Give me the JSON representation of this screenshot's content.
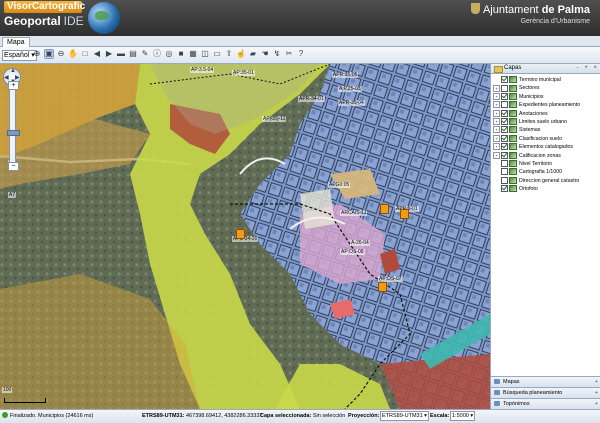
{
  "header": {
    "visor_label": "VisorCartografic",
    "geoportal_label": "Geoportal",
    "ide_label": "IDE",
    "org_prefix": "Ajuntament",
    "org_name": "de Palma",
    "org_dept": "Gerència d'Urbanisme"
  },
  "tabs": [
    {
      "label": "Mapa"
    }
  ],
  "toolbar": {
    "language": "Español",
    "tool_icons": [
      "zoom-in-icon",
      "zoom-box-icon",
      "zoom-out-icon",
      "pan-icon",
      "zoom-extent-icon",
      "back-icon",
      "forward-icon",
      "ruler-icon",
      "area-icon",
      "pencil-icon",
      "info-icon",
      "locate-icon",
      "stop-icon",
      "print-icon",
      "layer-add-icon",
      "select-icon",
      "export-icon",
      "pointer-icon",
      "bookmark-icon",
      "hand-icon",
      "route-icon",
      "tools-icon",
      "help-icon"
    ]
  },
  "map": {
    "labels": [
      "AP:3.5-04",
      "AP:35-01",
      "APR:35-05",
      "A:P,25-03",
      "AP(05)-11",
      "APR-34-01",
      "APR-35-04",
      "APG0:05",
      "APR:6-01",
      "APS-34-20",
      "A-26-04",
      "ARCA/S-11",
      "AP:OS-08",
      "AP:OS-07",
      "A7",
      "A7",
      "100"
    ]
  },
  "panel": {
    "title": "Capas",
    "controls": "- + ×",
    "layers": [
      {
        "label": "Termino municipal",
        "expand": "",
        "checked": true
      },
      {
        "label": "Sectores",
        "expand": "+",
        "checked": false
      },
      {
        "label": "Municipios",
        "expand": "+",
        "checked": true
      },
      {
        "label": "Expedientes planeamiento",
        "expand": "+",
        "checked": false
      },
      {
        "label": "Anotaciones",
        "expand": "+",
        "checked": true
      },
      {
        "label": "Limites suelo urbano",
        "expand": "+",
        "checked": true
      },
      {
        "label": "Sistemas",
        "expand": "+",
        "checked": true
      },
      {
        "label": "Clasificacion suelo",
        "expand": "+",
        "checked": true
      },
      {
        "label": "Elementos catalogados",
        "expand": "+",
        "checked": true
      },
      {
        "label": "Calificacion zonas",
        "expand": "+",
        "checked": true
      },
      {
        "label": "Nivel Territorio",
        "expand": "",
        "checked": false
      },
      {
        "label": "Cartografia 1/1000",
        "expand": "",
        "checked": false
      },
      {
        "label": "Direccion general catastro",
        "expand": "",
        "checked": false
      },
      {
        "label": "Ortofoto",
        "expand": "",
        "checked": true
      }
    ],
    "accordions": [
      {
        "label": "Mapas",
        "icon": "map-icon"
      },
      {
        "label": "Búsqueda planeamiento",
        "icon": "search-icon"
      },
      {
        "label": "Topónimos",
        "icon": "place-icon"
      }
    ]
  },
  "status": {
    "state": "Finalizado.",
    "message": "Municipios (24616 ms)",
    "crs_label": "ETRS89-UTM31:",
    "coords": "467398.69412, 4382286.33337",
    "selected_label": "Capa seleccionada:",
    "selected_value": "Sin selección",
    "projection_label": "Proyección:",
    "projection_value": "ETRS89-UTM31",
    "scale_label": "Escala:",
    "scale_value": "1:5000"
  },
  "colors": {
    "zone_yellow": "#c9d94a",
    "zone_orange": "#d9a63a",
    "zone_blue": "#7e97c6",
    "zone_red": "#b04a3a"
  }
}
